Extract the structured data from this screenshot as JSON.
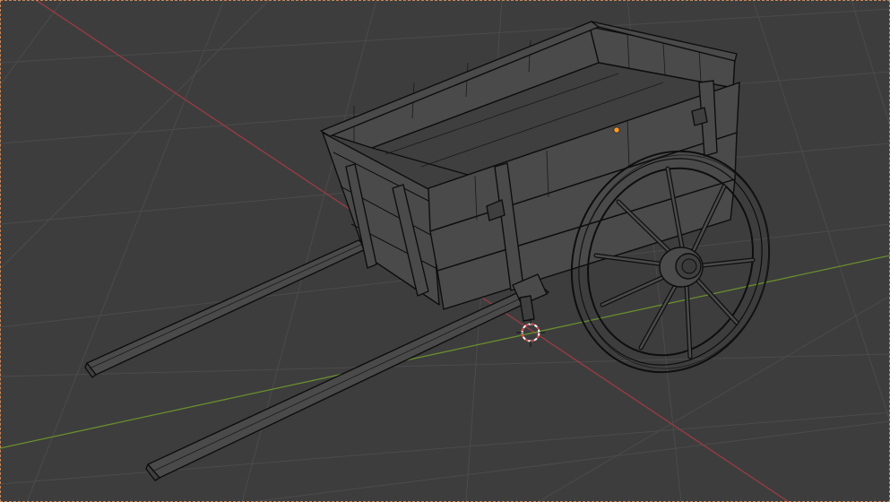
{
  "app": {
    "editor": "3D Viewport",
    "object": "Cart"
  },
  "viewport": {
    "background": "#3d3d3d",
    "grid_color": "#4b4b4b",
    "x_axis_color": "#9c3b45",
    "y_axis_color": "#6a8e2e",
    "wire_color": "#0e0e0e",
    "origin_color": "#ff9a1f",
    "cursor_color_a": "#e24b4b",
    "cursor_color_b": "#ffffff"
  },
  "icons": {
    "cursor": "3d-cursor-icon",
    "origin": "object-origin-icon"
  }
}
